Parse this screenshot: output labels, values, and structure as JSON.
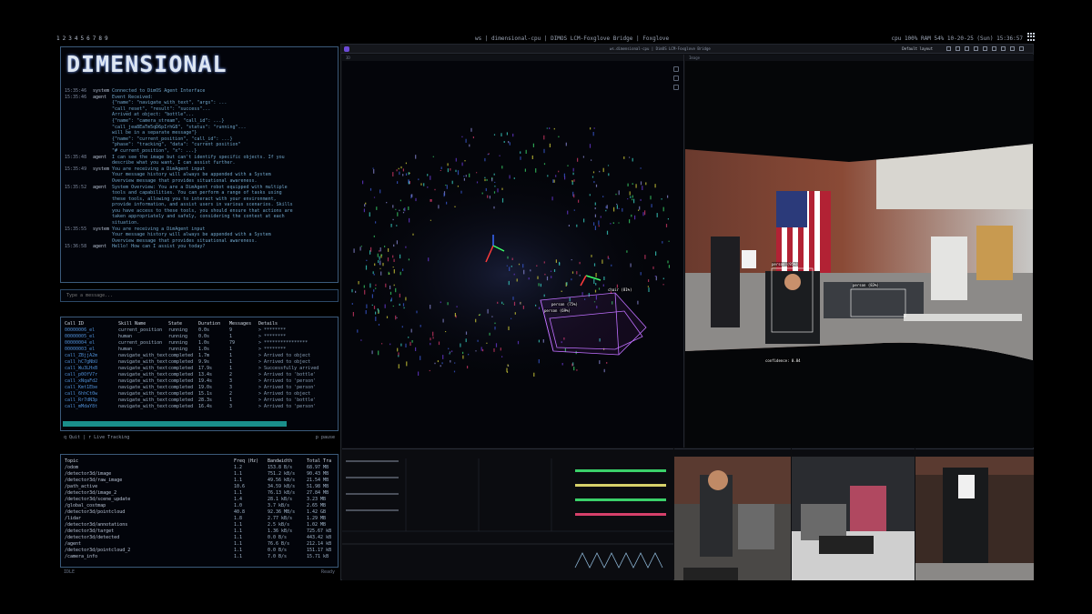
{
  "topbar": {
    "workspaces": [
      "1",
      "2",
      "3",
      "4",
      "5",
      "6",
      "7",
      "8",
      "9"
    ],
    "title": "ws | dimensional-cpu | DIMOS LCM-Foxglove Bridge | Foxglove",
    "right_status": "cpu 100% RAM 54% 10-20-25 (Sun) 15:36:57"
  },
  "terminal": {
    "logo": "DIMENSIONAL",
    "log": [
      {
        "t": "15:35:46",
        "role": "system",
        "msg": "Connected to DimOS Agent Interface"
      },
      {
        "t": "15:35:46",
        "role": "agent",
        "msg": "Event Received:"
      },
      {
        "t": "",
        "role": "",
        "msg": "{\"name\": \"navigate_with_text\", \"args\": ..."
      },
      {
        "t": "",
        "role": "",
        "msg": "\"call_reset\", \"result\": \"success\"..."
      },
      {
        "t": "",
        "role": "",
        "msg": "Arrived at object: \"bottle\"..."
      },
      {
        "t": "",
        "role": "",
        "msg": "{\"name\": \"camera_stream\", \"call_id\": ...}"
      },
      {
        "t": "",
        "role": "",
        "msg": "\"call_jea8EaTm5qD6pIrhG8\", \"status\": \"running\"..."
      },
      {
        "t": "",
        "role": "",
        "msg": "will be in a separate message\"}"
      },
      {
        "t": "",
        "role": "",
        "msg": "{\"name\": \"current_position\", \"call_id\": ...}"
      },
      {
        "t": "",
        "role": "",
        "msg": "\"phase\": \"tracking\", \"data\": \"current position\""
      },
      {
        "t": "",
        "role": "",
        "msg": "\"# current_position\", \"x\": ...}"
      },
      {
        "t": "15:35:48",
        "role": "agent",
        "msg": "I can see the image but can't identify specific objects. If you"
      },
      {
        "t": "",
        "role": "",
        "msg": "describe what you want, I can assist further."
      },
      {
        "t": "15:35:49",
        "role": "system",
        "msg": "You are receiving a DimAgent input"
      },
      {
        "t": "",
        "role": "",
        "msg": "Your message history will always be appended with a System"
      },
      {
        "t": "",
        "role": "",
        "msg": "Overview message that provides situational awareness."
      },
      {
        "t": "15:35:52",
        "role": "agent",
        "msg": "System Overview: You are a DimAgent robot equipped with multiple"
      },
      {
        "t": "",
        "role": "",
        "msg": "tools and capabilities. You can perform a range of tasks using"
      },
      {
        "t": "",
        "role": "",
        "msg": "these tools, allowing you to interact with your environment,"
      },
      {
        "t": "",
        "role": "",
        "msg": "provide information, and assist users in various scenarios. Skills"
      },
      {
        "t": "",
        "role": "",
        "msg": "you have access to these tools, you should ensure that actions are"
      },
      {
        "t": "",
        "role": "",
        "msg": "taken appropriately and safely, considering the context at each"
      },
      {
        "t": "",
        "role": "",
        "msg": "situation."
      },
      {
        "t": "15:35:55",
        "role": "system",
        "msg": "You are receiving a DimAgent input"
      },
      {
        "t": "",
        "role": "",
        "msg": "Your message history will always be appended with a System"
      },
      {
        "t": "",
        "role": "",
        "msg": "Overview message that provides situational awareness."
      },
      {
        "t": "15:36:58",
        "role": "agent",
        "msg": "Hello! How can I assist you today?"
      }
    ]
  },
  "input": {
    "placeholder": "Type a message..."
  },
  "tools": {
    "headers": [
      "Call ID",
      "Skill Name",
      "State",
      "Duration",
      "Messages",
      "Details"
    ],
    "rows": [
      [
        "00000006_el",
        "current_position",
        "running",
        "0.0s",
        "9",
        "> ********"
      ],
      [
        "00000005_el",
        "human",
        "running",
        "0.0s",
        "1",
        "> ********"
      ],
      [
        "00000004_el",
        "current_position",
        "running",
        "1.0s",
        "79",
        "> ****************"
      ],
      [
        "00000003_el",
        "human",
        "running",
        "1.0s",
        "1",
        "> ********"
      ],
      [
        "call_ZBjjA2m",
        "navigate_with_text",
        "completed",
        "1.7m",
        "1",
        "> Arrived to object"
      ],
      [
        "call_hC7gNbU",
        "navigate_with_text",
        "completed",
        "9.9s",
        "1",
        "> Arrived to object"
      ],
      [
        "call_Wu3LHxB",
        "navigate_with_text",
        "completed",
        "17.9s",
        "1",
        "> Successfully arrived"
      ],
      [
        "call_p0OfV7r",
        "navigate_with_text",
        "completed",
        "13.4s",
        "2",
        "> Arrived to 'bottle'"
      ],
      [
        "call_xNqaFd2",
        "navigate_with_text",
        "completed",
        "19.4s",
        "3",
        "> Arrived to 'person'"
      ],
      [
        "call_Kmt1Ebe",
        "navigate_with_text",
        "completed",
        "19.0s",
        "3",
        "> Arrived to 'person'"
      ],
      [
        "call_6hhCt0w",
        "navigate_with_text",
        "completed",
        "15.1s",
        "2",
        "> Arrived to object"
      ],
      [
        "call_Rr7dN3p",
        "navigate_with_text",
        "completed",
        "28.3s",
        "1",
        "> Arrived to 'bottle'"
      ],
      [
        "call_mMdaY8t",
        "navigate_with_text",
        "completed",
        "16.4s",
        "3",
        "> Arrived to 'person'"
      ]
    ]
  },
  "status": {
    "left": "q Quit | r Live Tracking",
    "right": "p pause"
  },
  "topics": {
    "headers": [
      "Topic",
      "Freq (Hz)",
      "Bandwidth",
      "Total Tra"
    ],
    "rows": [
      [
        "/odom",
        "1.2",
        "153.8 B/s",
        "68.97 MB"
      ],
      [
        "/detector3d/image",
        "1.1",
        "751.2 kB/s",
        "90.43 MB"
      ],
      [
        "/detector3d/raw_image",
        "1.1",
        "49.56 kB/s",
        "21.54 MB"
      ],
      [
        "/path_active",
        "10.6",
        "34.59 kB/s",
        "51.98 MB"
      ],
      [
        "/detector3d/image_2",
        "1.1",
        "76.13 kB/s",
        "27.84 MB"
      ],
      [
        "/detector3d/scene_update",
        "1.4",
        "28.1 kB/s",
        "3.23 MB"
      ],
      [
        "/global_costmap",
        "1.0",
        "3.7 kB/s",
        "2.65 MB"
      ],
      [
        "/detector3d/pointcloud",
        "40.8",
        "92.36 MB/s",
        "1.42 GB"
      ],
      [
        "/lidar",
        "1.8",
        "2.77 kB/s",
        "1.29 MB"
      ],
      [
        "/detector3d/annotations",
        "1.1",
        "2.5 kB/s",
        "1.02 MB"
      ],
      [
        "/detector3d/target",
        "1.1",
        "1.36 kB/s",
        "725.67 kB"
      ],
      [
        "/detector3d/detected",
        "1.1",
        "0.0 B/s",
        "443.42 kB"
      ],
      [
        "/agent",
        "1.1",
        "76.6 B/s",
        "212.14 kB"
      ],
      [
        "/detector3d/pointcloud_2",
        "1.1",
        "0.0 B/s",
        "151.17 kB"
      ],
      [
        "/camera_info",
        "1.1",
        "7.0 B/s",
        "15.71 kB"
      ]
    ]
  },
  "bottom": {
    "left": "IDLE",
    "right": "Ready"
  },
  "foxglove": {
    "title": "ws.dimensional-cpu | DimOS LCM-Foxglove Bridge",
    "layout": "Default layout",
    "panel_3d": "3D",
    "panel_image": "Image",
    "annotations": {
      "chair": "chair (81%)",
      "person1": "person (75%)",
      "person2": "person (69%)",
      "detected": "person (95%)",
      "cam_label": "person (83%)",
      "conf": "confidence: 0.84"
    }
  },
  "colors": {
    "accent": "#1a8f8a",
    "border": "#3b5a7a",
    "link": "#4f8fd6"
  }
}
